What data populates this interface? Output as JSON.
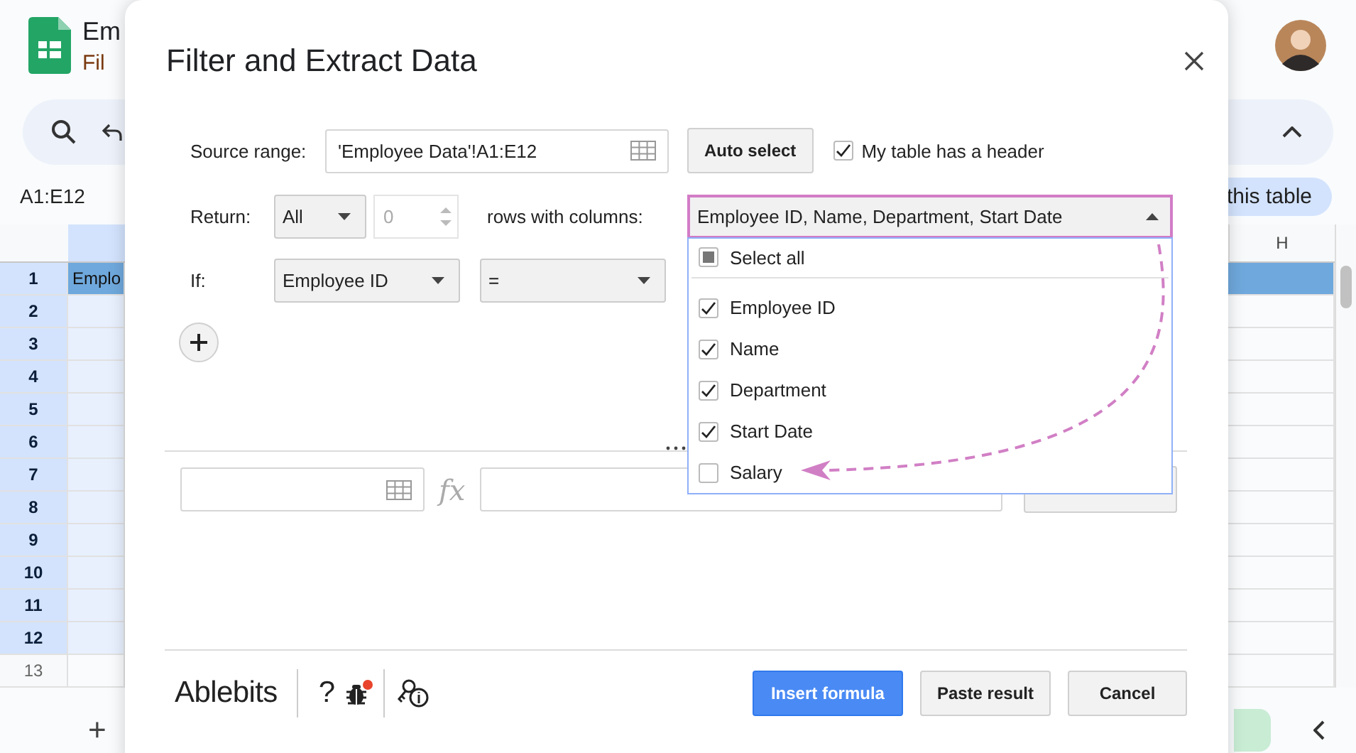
{
  "sheet": {
    "title": "Em",
    "menu": "Fil",
    "name_box": "A1:E12",
    "chip": "this table",
    "column_h": "H",
    "cell_a1": "Emplo",
    "add_sheet": "+",
    "rows": [
      {
        "number": "1",
        "selected": true,
        "kind": "header"
      },
      {
        "number": "2",
        "selected": true,
        "kind": "data"
      },
      {
        "number": "3",
        "selected": true,
        "kind": "data"
      },
      {
        "number": "4",
        "selected": true,
        "kind": "data"
      },
      {
        "number": "5",
        "selected": true,
        "kind": "data"
      },
      {
        "number": "6",
        "selected": true,
        "kind": "data"
      },
      {
        "number": "7",
        "selected": true,
        "kind": "data"
      },
      {
        "number": "8",
        "selected": true,
        "kind": "data"
      },
      {
        "number": "9",
        "selected": true,
        "kind": "data"
      },
      {
        "number": "10",
        "selected": true,
        "kind": "data"
      },
      {
        "number": "11",
        "selected": true,
        "kind": "data"
      },
      {
        "number": "12",
        "selected": true,
        "kind": "data"
      },
      {
        "number": "13",
        "selected": false,
        "kind": "data"
      }
    ]
  },
  "dialog": {
    "title": "Filter and Extract Data",
    "source_range": {
      "label": "Source range:",
      "value": "'Employee Data'!A1:E12"
    },
    "auto_select": "Auto select",
    "header_checkbox": {
      "label": "My table has a header",
      "checked": true
    },
    "return": {
      "label": "Return:",
      "mode": "All",
      "count": "0",
      "count_disabled": true,
      "columns_label": "rows with columns:",
      "columns_value": "Employee ID, Name, Department, Start Date",
      "expanded": true
    },
    "column_options": {
      "select_all": {
        "label": "Select all",
        "checked": false,
        "indeterminate": true
      },
      "items": [
        {
          "label": "Employee ID",
          "checked": true
        },
        {
          "label": "Name",
          "checked": true
        },
        {
          "label": "Department",
          "checked": true
        },
        {
          "label": "Start Date",
          "checked": true
        },
        {
          "label": "Salary",
          "checked": false
        }
      ]
    },
    "condition": {
      "label": "If:",
      "column": "Employee ID",
      "operator": "="
    },
    "fx": "fx",
    "footer": {
      "brand": "Ablebits",
      "help": "?",
      "buttons": [
        {
          "label": "Insert formula",
          "kind": "primary"
        },
        {
          "label": "Paste result",
          "kind": "default"
        },
        {
          "label": "Cancel",
          "kind": "default"
        }
      ]
    }
  }
}
